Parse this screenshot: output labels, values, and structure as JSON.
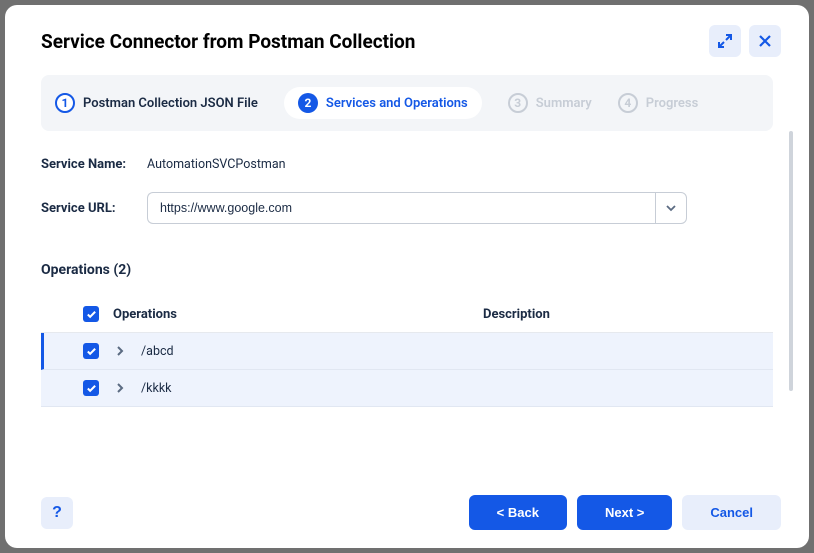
{
  "header": {
    "title": "Service Connector from Postman Collection"
  },
  "stepper": {
    "steps": [
      {
        "num": "1",
        "label": "Postman Collection JSON File"
      },
      {
        "num": "2",
        "label": "Services and Operations"
      },
      {
        "num": "3",
        "label": "Summary"
      },
      {
        "num": "4",
        "label": "Progress"
      }
    ]
  },
  "form": {
    "service_name_label": "Service Name:",
    "service_name_value": "AutomationSVCPostman",
    "service_url_label": "Service URL:",
    "service_url_value": "https://www.google.com"
  },
  "operations": {
    "title": "Operations (2)",
    "head_ops": "Operations",
    "head_desc": "Description",
    "rows": [
      {
        "path": "/abcd"
      },
      {
        "path": "/kkkk"
      }
    ]
  },
  "footer": {
    "help": "?",
    "back": "< Back",
    "next": "Next >",
    "cancel": "Cancel"
  }
}
